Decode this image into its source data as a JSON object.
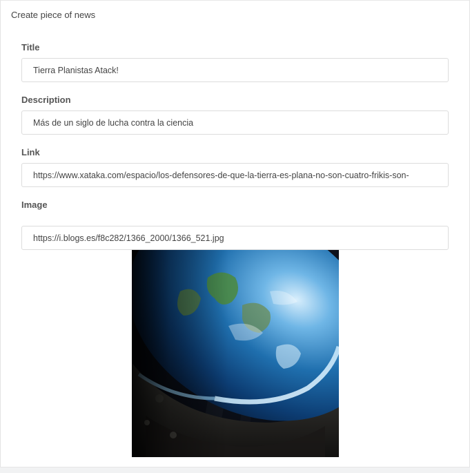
{
  "card": {
    "title": "Create piece of news"
  },
  "form": {
    "title": {
      "label": "Title",
      "value": "Tierra Planistas Atack!"
    },
    "description": {
      "label": "Description",
      "value": "Más de un siglo de lucha contra la ciencia"
    },
    "link": {
      "label": "Link",
      "value": "https://www.xataka.com/espacio/los-defensores-de-que-la-tierra-es-plana-no-son-cuatro-frikis-son-"
    },
    "image": {
      "label": "Image",
      "value": "https://i.blogs.es/f8c282/1366_2000/1366_521.jpg"
    }
  },
  "preview": {
    "icon": "flat-earth-image"
  }
}
